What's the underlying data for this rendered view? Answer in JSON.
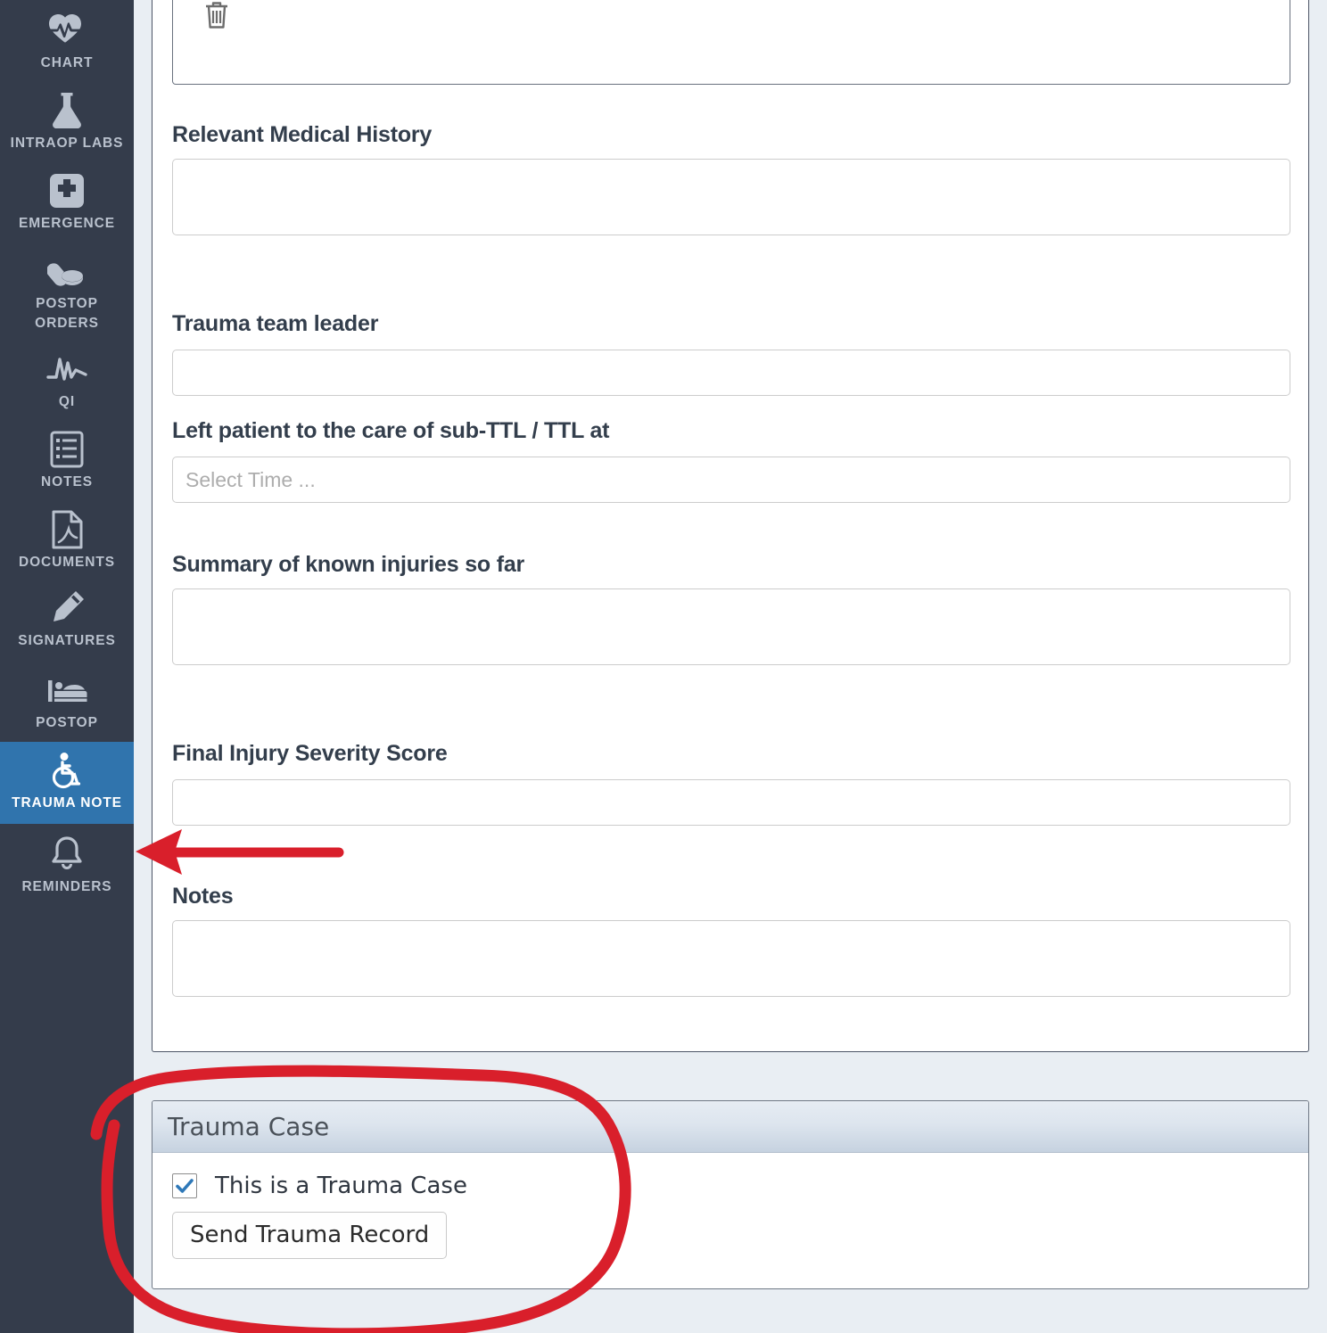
{
  "sidebar": {
    "items": [
      {
        "label": "CHART",
        "icon": "heart-pulse-icon",
        "active": false
      },
      {
        "label": "INTRAOP LABS",
        "icon": "flask-icon",
        "active": false
      },
      {
        "label": "EMERGENCE",
        "icon": "medical-cross-icon",
        "active": false
      },
      {
        "label": "POSTOP ORDERS",
        "icon": "pills-icon",
        "active": false
      },
      {
        "label": "QI",
        "icon": "waveform-icon",
        "active": false
      },
      {
        "label": "NOTES",
        "icon": "list-document-icon",
        "active": false
      },
      {
        "label": "DOCUMENTS",
        "icon": "pdf-file-icon",
        "active": false
      },
      {
        "label": "SIGNATURES",
        "icon": "pen-icon",
        "active": false
      },
      {
        "label": "POSTOP",
        "icon": "bed-icon",
        "active": false
      },
      {
        "label": "TRAUMA NOTE",
        "icon": "wheelchair-icon",
        "active": true
      },
      {
        "label": "REMINDERS",
        "icon": "bell-icon",
        "active": false
      }
    ]
  },
  "form": {
    "delete_icon": "trash-icon",
    "fields": [
      {
        "label": "Relevant Medical History",
        "value": "",
        "placeholder": "",
        "type": "textarea"
      },
      {
        "label": "Trauma team leader",
        "value": "",
        "placeholder": "",
        "type": "text"
      },
      {
        "label": "Left patient to the care of sub-TTL / TTL at",
        "value": "",
        "placeholder": "Select Time ...",
        "type": "time"
      },
      {
        "label": "Summary of known injuries so far",
        "value": "",
        "placeholder": "",
        "type": "textarea"
      },
      {
        "label": "Final Injury Severity Score",
        "value": "",
        "placeholder": "",
        "type": "text"
      },
      {
        "label": "Notes",
        "value": "",
        "placeholder": "",
        "type": "textarea"
      }
    ]
  },
  "trauma_case": {
    "panel_title": "Trauma Case",
    "checkbox_label": "This is a Trauma Case",
    "checkbox_checked": true,
    "send_button_label": "Send Trauma Record"
  },
  "colors": {
    "sidebar_bg": "#343c4b",
    "sidebar_active": "#3074ad",
    "sidebar_text": "#b9c1cd",
    "label_text": "#333e4c",
    "annotation_red": "#d91f2b",
    "page_bg": "#e9eef3",
    "checkbox_check": "#2e78b8"
  },
  "annotations": [
    {
      "name": "red-arrow-pointing-to-trauma-note-tab",
      "shape": "arrow",
      "direction": "left"
    },
    {
      "name": "red-circle-around-trauma-case-panel",
      "shape": "ellipse"
    }
  ]
}
